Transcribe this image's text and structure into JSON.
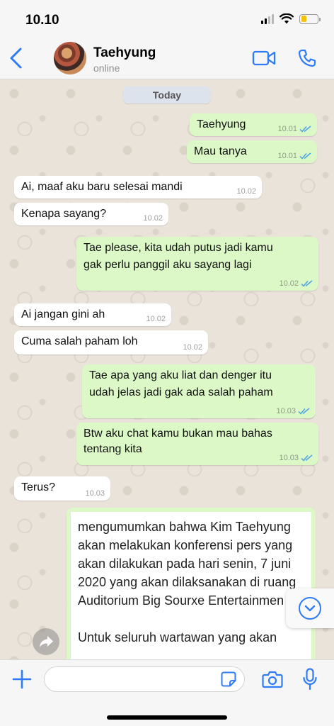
{
  "status_bar": {
    "time": "10.10",
    "icons": [
      "cellular-signal-icon",
      "wifi-icon",
      "battery-icon"
    ],
    "battery_level": 0.35,
    "battery_color": "#f4c20d"
  },
  "header": {
    "back_icon": "chevron-left-icon",
    "contact_name": "Taehyung",
    "contact_status": "online",
    "video_icon": "video-camera-icon",
    "call_icon": "phone-icon",
    "accent_color": "#2f7cf6"
  },
  "chat": {
    "day_label": "Today",
    "outgoing_color": "#dcf8c6",
    "incoming_color": "#ffffff",
    "read_tick_color": "#4fa3e0",
    "messages": [
      {
        "direction": "out",
        "lines": [
          "Taehyung"
        ],
        "time": "10.01",
        "status": "read"
      },
      {
        "direction": "out",
        "lines": [
          "Mau tanya"
        ],
        "time": "10.01",
        "status": "read"
      },
      {
        "direction": "in",
        "lines": [
          "Ai, maaf aku baru selesai mandi"
        ],
        "time": "10.02"
      },
      {
        "direction": "in",
        "lines": [
          "Kenapa sayang?"
        ],
        "time": "10.02"
      },
      {
        "direction": "out",
        "lines": [
          "Tae please, kita udah putus jadi kamu",
          "gak perlu panggil aku sayang lagi"
        ],
        "time": "10.02",
        "status": "read"
      },
      {
        "direction": "in",
        "lines": [
          "Ai jangan gini ah"
        ],
        "time": "10.02"
      },
      {
        "direction": "in",
        "lines": [
          "Cuma salah paham loh"
        ],
        "time": "10.02"
      },
      {
        "direction": "out",
        "lines": [
          "Tae apa yang aku liat dan denger itu",
          "udah jelas jadi gak ada salah paham"
        ],
        "time": "10.03",
        "status": "read"
      },
      {
        "direction": "out",
        "lines": [
          "Btw aku chat kamu bukan mau bahas",
          "tentang kita"
        ],
        "time": "10.03",
        "status": "read"
      },
      {
        "direction": "in",
        "lines": [
          "Terus?"
        ],
        "time": "10.03"
      }
    ],
    "forwarded_card": {
      "lines": [
        "mengumumkan bahwa Kim Taehyung",
        "akan melakukan konferensi pers yang",
        "akan dilakukan pada hari senin, 7 juni",
        "2020 yang akan dilaksanakan di ruang",
        "Auditorium Big Sourxe Entertainmen",
        "",
        "Untuk seluruh wartawan yang akan"
      ]
    },
    "forward_icon": "forward-arrow-icon",
    "scroll_down_icon": "chevron-down-circle-icon"
  },
  "input_bar": {
    "plus_icon": "plus-icon",
    "input_value": "",
    "sticker_icon": "sticker-icon",
    "camera_icon": "camera-icon",
    "mic_icon": "microphone-icon"
  }
}
